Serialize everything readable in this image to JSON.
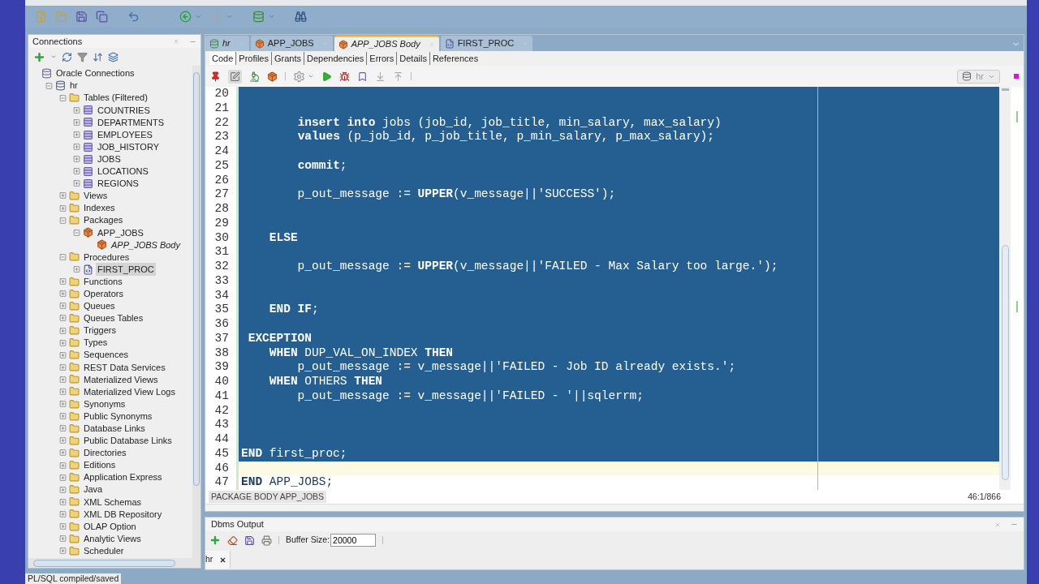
{
  "main_toolbar": {
    "buttons": [
      {
        "kind": "new"
      },
      {
        "kind": "open"
      },
      {
        "kind": "save"
      },
      {
        "kind": "save-all"
      },
      {
        "kind": "undo"
      },
      {
        "kind": "redo",
        "disabled": true
      },
      {
        "kind": "back"
      },
      {
        "kind": "forward",
        "disabled": true
      },
      {
        "kind": "sql"
      },
      {
        "kind": "find"
      }
    ]
  },
  "connections": {
    "title": "Connections",
    "tree": [
      {
        "label": "Oracle Connections",
        "kind": "root",
        "selected": false,
        "children": [
          {
            "label": "hr",
            "kind": "connection",
            "expanded": true,
            "selected": false,
            "children": [
              {
                "label": "Tables (Filtered)",
                "kind": "folder",
                "expanded": true,
                "selected": false,
                "children": [
                  {
                    "label": "COUNTRIES",
                    "kind": "table",
                    "expanded": false,
                    "selected": false
                  },
                  {
                    "label": "DEPARTMENTS",
                    "kind": "table",
                    "expanded": false,
                    "selected": false
                  },
                  {
                    "label": "EMPLOYEES",
                    "kind": "table",
                    "expanded": false,
                    "selected": false
                  },
                  {
                    "label": "JOB_HISTORY",
                    "kind": "table",
                    "expanded": false,
                    "selected": false
                  },
                  {
                    "label": "JOBS",
                    "kind": "table",
                    "expanded": false,
                    "selected": false
                  },
                  {
                    "label": "LOCATIONS",
                    "kind": "table",
                    "expanded": false,
                    "selected": false
                  },
                  {
                    "label": "REGIONS",
                    "kind": "table",
                    "expanded": false,
                    "selected": false
                  }
                ]
              },
              {
                "label": "Views",
                "kind": "folder",
                "expanded": false,
                "selected": false
              },
              {
                "label": "Indexes",
                "kind": "folder",
                "expanded": false,
                "selected": false
              },
              {
                "label": "Packages",
                "kind": "folder",
                "expanded": true,
                "selected": false,
                "children": [
                  {
                    "label": "APP_JOBS",
                    "kind": "package",
                    "expanded": true,
                    "selected": false,
                    "children": [
                      {
                        "label": "APP_JOBS Body",
                        "kind": "package-body",
                        "selected": false
                      }
                    ]
                  }
                ]
              },
              {
                "label": "Procedures",
                "kind": "folder",
                "expanded": true,
                "selected": false,
                "children": [
                  {
                    "label": "FIRST_PROC",
                    "kind": "procedure",
                    "expanded": false,
                    "selected": true
                  }
                ]
              },
              {
                "label": "Functions",
                "kind": "folder",
                "expanded": false,
                "selected": false
              },
              {
                "label": "Operators",
                "kind": "folder",
                "expanded": false,
                "selected": false
              },
              {
                "label": "Queues",
                "kind": "folder",
                "expanded": false,
                "selected": false
              },
              {
                "label": "Queues Tables",
                "kind": "folder",
                "expanded": false,
                "selected": false
              },
              {
                "label": "Triggers",
                "kind": "folder",
                "expanded": false,
                "selected": false
              },
              {
                "label": "Types",
                "kind": "folder",
                "expanded": false,
                "selected": false
              },
              {
                "label": "Sequences",
                "kind": "folder",
                "expanded": false,
                "selected": false
              },
              {
                "label": "REST Data Services",
                "kind": "folder",
                "expanded": false,
                "selected": false
              },
              {
                "label": "Materialized Views",
                "kind": "folder",
                "expanded": false,
                "selected": false
              },
              {
                "label": "Materialized View Logs",
                "kind": "folder",
                "expanded": false,
                "selected": false
              },
              {
                "label": "Synonyms",
                "kind": "folder",
                "expanded": false,
                "selected": false
              },
              {
                "label": "Public Synonyms",
                "kind": "folder",
                "expanded": false,
                "selected": false
              },
              {
                "label": "Database Links",
                "kind": "folder",
                "expanded": false,
                "selected": false
              },
              {
                "label": "Public Database Links",
                "kind": "folder",
                "expanded": false,
                "selected": false
              },
              {
                "label": "Directories",
                "kind": "folder",
                "expanded": false,
                "selected": false
              },
              {
                "label": "Editions",
                "kind": "folder",
                "expanded": false,
                "selected": false
              },
              {
                "label": "Application Express",
                "kind": "folder",
                "expanded": false,
                "selected": false
              },
              {
                "label": "Java",
                "kind": "folder",
                "expanded": false,
                "selected": false
              },
              {
                "label": "XML Schemas",
                "kind": "folder",
                "expanded": false,
                "selected": false
              },
              {
                "label": "XML DB Repository",
                "kind": "folder",
                "expanded": false,
                "selected": false
              },
              {
                "label": "OLAP Option",
                "kind": "folder",
                "expanded": false,
                "selected": false
              },
              {
                "label": "Analytic Views",
                "kind": "folder",
                "expanded": false,
                "selected": false
              },
              {
                "label": "Scheduler",
                "kind": "folder",
                "expanded": false,
                "selected": false
              }
            ]
          }
        ]
      }
    ]
  },
  "editor_tabs": [
    {
      "label": "hr",
      "kind": "connection",
      "italic": true,
      "selected": false
    },
    {
      "label": "APP_JOBS",
      "kind": "package",
      "italic": false,
      "selected": false
    },
    {
      "label": "APP_JOBS Body",
      "kind": "package",
      "italic": true,
      "selected": true
    },
    {
      "label": "FIRST_PROC",
      "kind": "procedure",
      "italic": false,
      "selected": false
    }
  ],
  "sub_tabs": [
    {
      "label": "Code",
      "selected": true
    },
    {
      "label": "Profiles",
      "selected": false
    },
    {
      "label": "Grants",
      "selected": false
    },
    {
      "label": "Dependencies",
      "selected": false
    },
    {
      "label": "Errors",
      "selected": false
    },
    {
      "label": "Details",
      "selected": false
    },
    {
      "label": "References",
      "selected": false
    }
  ],
  "connection_picker": {
    "value": "hr"
  },
  "code_lines": [
    {
      "number": "20",
      "selected": true,
      "current": false
    },
    {
      "number": "21",
      "selected": true,
      "current": false
    },
    {
      "number": "22",
      "selected": true,
      "current": false,
      "text": "        **insert into** jobs (job_id, job_title, min_salary, max_salary)"
    },
    {
      "number": "23",
      "selected": true,
      "current": false,
      "text": "        **values** (p_job_id, p_job_title, p_min_salary, p_max_salary);"
    },
    {
      "number": "24",
      "selected": true,
      "current": false
    },
    {
      "number": "25",
      "selected": true,
      "current": false,
      "text": "        **commit**;"
    },
    {
      "number": "26",
      "selected": true,
      "current": false
    },
    {
      "number": "27",
      "selected": true,
      "current": false,
      "text": "        p_out_message := **UPPER**(v_message||'SUCCESS');"
    },
    {
      "number": "28",
      "selected": true,
      "current": false
    },
    {
      "number": "29",
      "selected": true,
      "current": false
    },
    {
      "number": "30",
      "selected": true,
      "current": false,
      "text": "    **ELSE**"
    },
    {
      "number": "31",
      "selected": true,
      "current": false
    },
    {
      "number": "32",
      "selected": true,
      "current": false,
      "text": "        p_out_message := **UPPER**(v_message||'FAILED - Max Salary too large.');"
    },
    {
      "number": "33",
      "selected": true,
      "current": false
    },
    {
      "number": "34",
      "selected": true,
      "current": false
    },
    {
      "number": "35",
      "selected": true,
      "current": false,
      "text": "    **END IF**;"
    },
    {
      "number": "36",
      "selected": true,
      "current": false
    },
    {
      "number": "37",
      "selected": true,
      "current": false,
      "text": " **EXCEPTION**"
    },
    {
      "number": "38",
      "selected": true,
      "current": false,
      "text": "    **WHEN** DUP_VAL_ON_INDEX **THEN**"
    },
    {
      "number": "39",
      "selected": true,
      "current": false,
      "text": "        p_out_message := v_message||'FAILED - Job ID already exists.';"
    },
    {
      "number": "40",
      "selected": true,
      "current": false,
      "text": "    **WHEN** OTHERS **THEN**"
    },
    {
      "number": "41",
      "selected": true,
      "current": false,
      "text": "        p_out_message := v_message||'FAILED - '||sqlerrm;"
    },
    {
      "number": "42",
      "selected": true,
      "current": false
    },
    {
      "number": "43",
      "selected": true,
      "current": false
    },
    {
      "number": "44",
      "selected": true,
      "current": false
    },
    {
      "number": "45",
      "selected": true,
      "current": false,
      "text": "**END** first_proc;"
    },
    {
      "number": "46",
      "selected": false,
      "current": true
    },
    {
      "number": "47",
      "selected": false,
      "current": false,
      "text": "**END** APP_JOBS;"
    }
  ],
  "breadcrumb": "PACKAGE BODY APP_JOBS",
  "caret_position": "46:1/866",
  "dbms_output": {
    "title": "Dbms Output",
    "buffer_label": "Buffer Size:",
    "buffer_value": "20000",
    "tabs": [
      {
        "label": "hr",
        "selected": true
      }
    ]
  },
  "status_bar": "PL/SQL compiled/saved"
}
